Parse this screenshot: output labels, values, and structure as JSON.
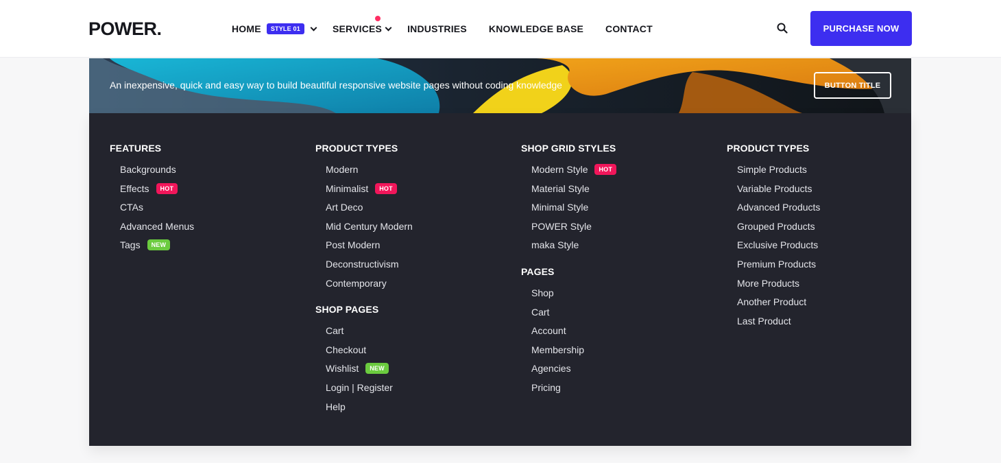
{
  "header": {
    "logo": "POWER.",
    "nav": [
      {
        "label": "HOME",
        "badge": "STYLE 01",
        "dropdown": true
      },
      {
        "label": "SERVICES",
        "dropdown": true,
        "dot": true
      },
      {
        "label": "INDUSTRIES"
      },
      {
        "label": "KNOWLEDGE BASE"
      },
      {
        "label": "CONTACT"
      }
    ],
    "search_icon": "search-icon",
    "cta_label": "PURCHASE NOW",
    "accent": "#3d2ef0"
  },
  "banner": {
    "text": "An inexpensive, quick and easy way to build beautiful responsive website pages without coding knowledge",
    "button_label": "BUTTON TITLE"
  },
  "menu": {
    "col1": {
      "title": "FEATURES",
      "items": [
        {
          "label": "Backgrounds"
        },
        {
          "label": "Effects",
          "tag": "HOT"
        },
        {
          "label": "CTAs"
        },
        {
          "label": "Advanced Menus"
        },
        {
          "label": "Tags",
          "tag": "NEW"
        }
      ]
    },
    "col2": {
      "title": "PRODUCT TYPES",
      "items": [
        {
          "label": "Modern"
        },
        {
          "label": "Minimalist",
          "tag": "HOT"
        },
        {
          "label": "Art Deco"
        },
        {
          "label": "Mid Century Modern"
        },
        {
          "label": "Post Modern"
        },
        {
          "label": "Deconstructivism"
        },
        {
          "label": "Contemporary"
        }
      ],
      "title2": "SHOP PAGES",
      "items2": [
        {
          "label": "Cart"
        },
        {
          "label": "Checkout"
        },
        {
          "label": "Wishlist",
          "tag": "NEW"
        },
        {
          "label": "Login | Register"
        },
        {
          "label": "Help"
        }
      ]
    },
    "col3": {
      "title": "SHOP GRID STYLES",
      "items": [
        {
          "label": "Modern Style",
          "tag": "HOT"
        },
        {
          "label": "Material Style"
        },
        {
          "label": "Minimal Style"
        },
        {
          "label": "POWER Style"
        },
        {
          "label": "maka Style"
        }
      ],
      "title2": "PAGES",
      "items2": [
        {
          "label": "Shop"
        },
        {
          "label": "Cart"
        },
        {
          "label": "Account"
        },
        {
          "label": "Membership"
        },
        {
          "label": "Agencies"
        },
        {
          "label": "Pricing"
        }
      ]
    },
    "col4": {
      "title": "PRODUCT TYPES",
      "items": [
        {
          "label": "Simple Products"
        },
        {
          "label": "Variable Products"
        },
        {
          "label": "Advanced Products"
        },
        {
          "label": "Grouped Products"
        },
        {
          "label": "Exclusive Products"
        },
        {
          "label": "Premium Products"
        },
        {
          "label": "More Products"
        },
        {
          "label": "Another Product"
        },
        {
          "label": "Last Product"
        }
      ]
    },
    "hot_color": "#f1165a",
    "new_color": "#6bcb3f"
  }
}
